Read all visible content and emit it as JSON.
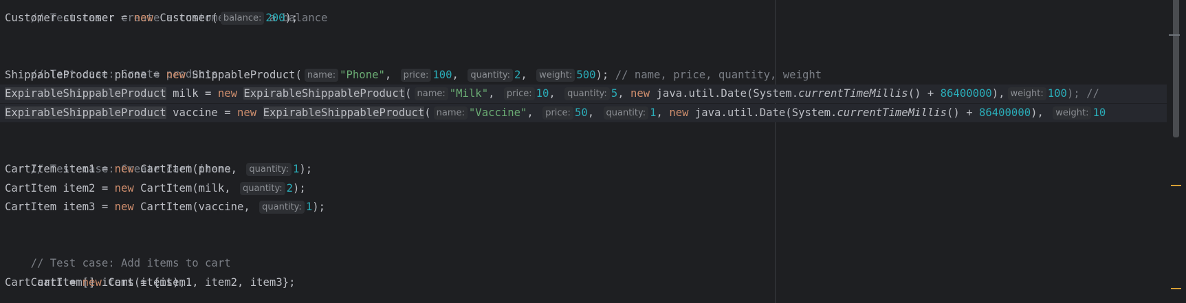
{
  "editor": {
    "hints": {
      "balance": "balance:",
      "name": "name:",
      "price": "price:",
      "quantity": "quantity:",
      "weight": "weight:"
    },
    "lines": {
      "l0": {
        "comment": "// Test case: create a customer with a balance"
      },
      "l1": {
        "p1": "Customer customer = ",
        "kw": "new",
        "p2": " Customer(",
        "n1": "200",
        "p3": ");"
      },
      "l3": {
        "comment": "// Test case: Create products"
      },
      "l4": {
        "p1": "ShippableProduct phone = ",
        "kw": "new",
        "p2": " ShippableProduct(",
        "s1": "\"Phone\"",
        "c1": ", ",
        "n1": "100",
        "c2": ", ",
        "n2": "2",
        "c3": ", ",
        "n3": "500",
        "p3": "); ",
        "comment": "// name, price, quantity, weight"
      },
      "l5": {
        "cls": "ExpirableShippableProduct",
        "p1": " milk = ",
        "kw": "new",
        "sp": " ",
        "cls2": "ExpirableShippableProduct",
        "p2": "(",
        "s1": "\"Milk\"",
        "c1": ", ",
        "n1": "10",
        "c2": ", ",
        "n2": "5",
        "c3": ", ",
        "kw2": "new",
        "p3": " java.util.Date(System.",
        "m1": "currentTimeMillis",
        "p4": "() + ",
        "n3": "86400000",
        "c4": "),",
        "n4": "100",
        "p5": "); //"
      },
      "l6": {
        "cls": "ExpirableShippableProduct",
        "p1": " vaccine = ",
        "kw": "new",
        "sp": " ",
        "cls2": "ExpirableShippableProduct",
        "p2": "(",
        "s1": "\"Vaccine\"",
        "c1": ", ",
        "n1": "50",
        "c2": ", ",
        "n2": "1",
        "c3": ", ",
        "kw2": "new",
        "p3": " java.util.Date(System.",
        "m1": "currentTimeMillis",
        "p4": "() + ",
        "n3": "86400000",
        "c4": "), ",
        "n4": "10"
      },
      "l8": {
        "comment": "// Test case: Create cart items"
      },
      "l9": {
        "p1": "CartItem item1 = ",
        "kw": "new",
        "p2": " CartItem(phone, ",
        "n1": "1",
        "p3": ");"
      },
      "l10": {
        "p1": "CartItem item2 = ",
        "kw": "new",
        "p2": " CartItem(milk, ",
        "n1": "2",
        "p3": ");"
      },
      "l11": {
        "p1": "CartItem item3 = ",
        "kw": "new",
        "p2": " CartItem(vaccine, ",
        "n1": "1",
        "p3": ");"
      },
      "l13": {
        "comment": "// Test case: Add items to cart"
      },
      "l14": {
        "text": "CartItem[] items = {item1, item2, item3};"
      },
      "l15": {
        "p1": "Cart cart = ",
        "kw": "new",
        "p2": " Cart(items);"
      }
    }
  }
}
